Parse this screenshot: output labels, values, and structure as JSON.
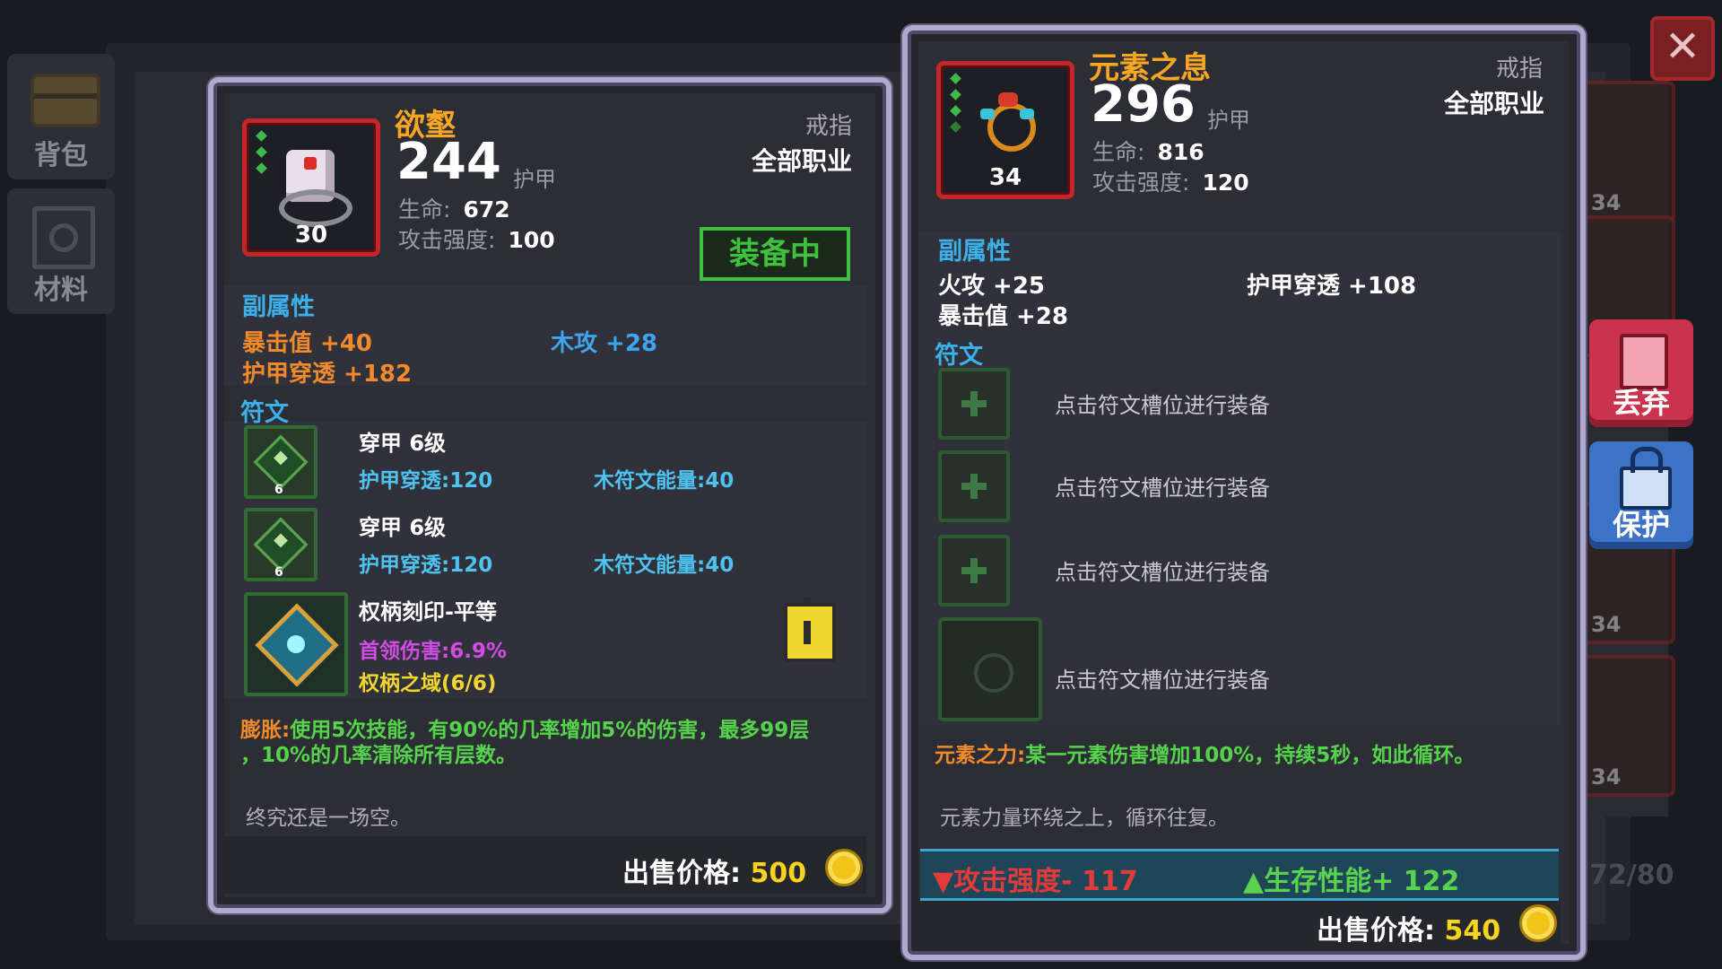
{
  "sidebar": {
    "bag_label": "背包",
    "materials_label": "材料"
  },
  "left_item": {
    "name": "欲壑",
    "level": "30",
    "main_value": "244",
    "main_unit": "护甲",
    "type": "戒指",
    "class": "全部职业",
    "stats": [
      {
        "label": "生命:",
        "value": "672"
      },
      {
        "label": "攻击强度:",
        "value": "100"
      }
    ],
    "equipped_label": "装备中",
    "sub_title": "副属性",
    "sub_stats": [
      "暴击值 +40",
      "木攻 +28",
      "护甲穿透 +182"
    ],
    "rune_title": "符文",
    "runes": [
      {
        "name": "穿甲 6级",
        "stat1": "护甲穿透:120",
        "stat2": "木符文能量:40",
        "level": "6"
      },
      {
        "name": "穿甲 6级",
        "stat1": "护甲穿透:120",
        "stat2": "木符文能量:40",
        "level": "6"
      }
    ],
    "seal": {
      "name": "权柄刻印-平等",
      "stat1": "首领伤害:6.9%",
      "stat2": "权柄之域(6/6)"
    },
    "effect_title": "膨胀:",
    "effect_text": "使用5次技能，有90%的几率增加5%的伤害，最多99层",
    "effect_text2": "，10%的几率清除所有层数。",
    "flavor": "终究还是一场空。",
    "price_label": "出售价格:",
    "price": "500"
  },
  "right_item": {
    "name": "元素之息",
    "level": "34",
    "main_value": "296",
    "main_unit": "护甲",
    "type": "戒指",
    "class": "全部职业",
    "stats": [
      {
        "label": "生命:",
        "value": "816"
      },
      {
        "label": "攻击强度:",
        "value": "120"
      }
    ],
    "sub_title": "副属性",
    "sub_stats": [
      "火攻 +25",
      "护甲穿透 +108",
      "暴击值 +28"
    ],
    "rune_title": "符文",
    "slot_hint": "点击符文槽位进行装备",
    "effect_title": "元素之力:",
    "effect_text": "某一元素伤害增加100%，持续5秒，如此循环。",
    "flavor": "元素力量环绕之上，循环往复。",
    "compare_down": "攻击强度- 117",
    "compare_up": "生存性能+ 122",
    "price_label": "出售价格:",
    "price": "540"
  },
  "actions": {
    "close": "✕",
    "discard": "丢弃",
    "protect": "保护"
  },
  "background": {
    "side_levels": [
      "34",
      "34",
      "34"
    ],
    "counter": "72/80"
  }
}
